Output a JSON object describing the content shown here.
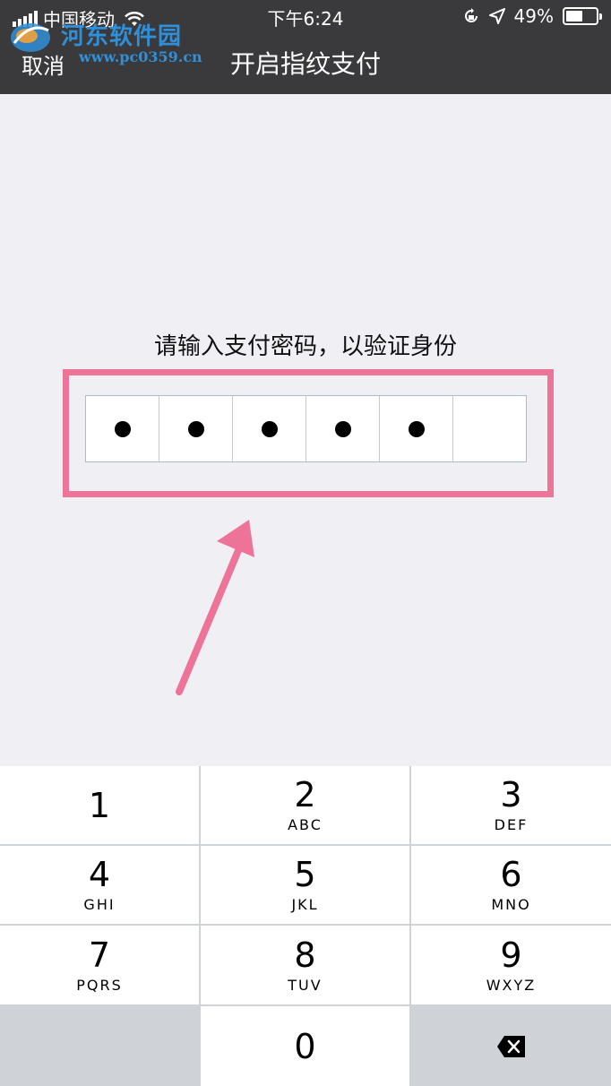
{
  "status_bar": {
    "carrier": "中国移动",
    "time": "下午6:24",
    "battery": "49%",
    "battery_level": 0.49
  },
  "watermark": {
    "title": "河东软件园",
    "url": "www.pc0359.cn"
  },
  "nav": {
    "cancel_label": "取消",
    "title": "开启指纹支付"
  },
  "prompt": "请输入支付密码，以验证身份",
  "pin": {
    "length": 6,
    "filled": 5
  },
  "keypad": {
    "keys": [
      {
        "num": "1",
        "letters": ""
      },
      {
        "num": "2",
        "letters": "ABC"
      },
      {
        "num": "3",
        "letters": "DEF"
      },
      {
        "num": "4",
        "letters": "GHI"
      },
      {
        "num": "5",
        "letters": "JKL"
      },
      {
        "num": "6",
        "letters": "MNO"
      },
      {
        "num": "7",
        "letters": "PQRS"
      },
      {
        "num": "8",
        "letters": "TUV"
      },
      {
        "num": "9",
        "letters": "WXYZ"
      },
      {
        "num": "0",
        "letters": ""
      }
    ]
  },
  "colors": {
    "header_bg": "#3a3a3c",
    "highlight": "#ee7399",
    "page_bg": "#efeff4",
    "watermark_blue": "#2f8fd8"
  }
}
